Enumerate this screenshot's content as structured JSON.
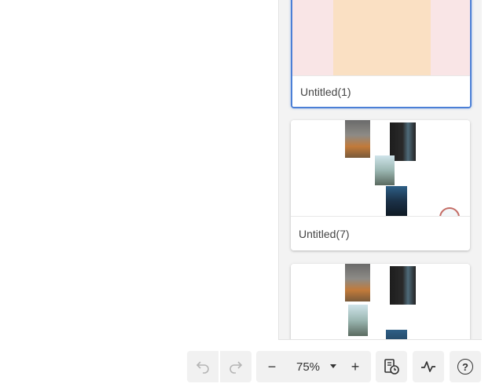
{
  "panel": {
    "cards": [
      {
        "title": "Untitled(1)",
        "selected": true
      },
      {
        "title": "Untitled(7)",
        "selected": false
      },
      {
        "title": "",
        "selected": false
      }
    ]
  },
  "toolbar": {
    "zoom_out_symbol": "−",
    "zoom_value": "75%",
    "zoom_in_symbol": "+",
    "help_symbol": "?"
  },
  "colors": {
    "accent": "#4b7fd6",
    "thumb1_background": "#f9e5e6",
    "thumb1_block": "#fae0c3"
  },
  "icons": [
    "undo-icon",
    "redo-icon",
    "zoom-dropdown-icon",
    "page-history-icon",
    "activity-icon",
    "help-icon",
    "sticker-icon"
  ]
}
